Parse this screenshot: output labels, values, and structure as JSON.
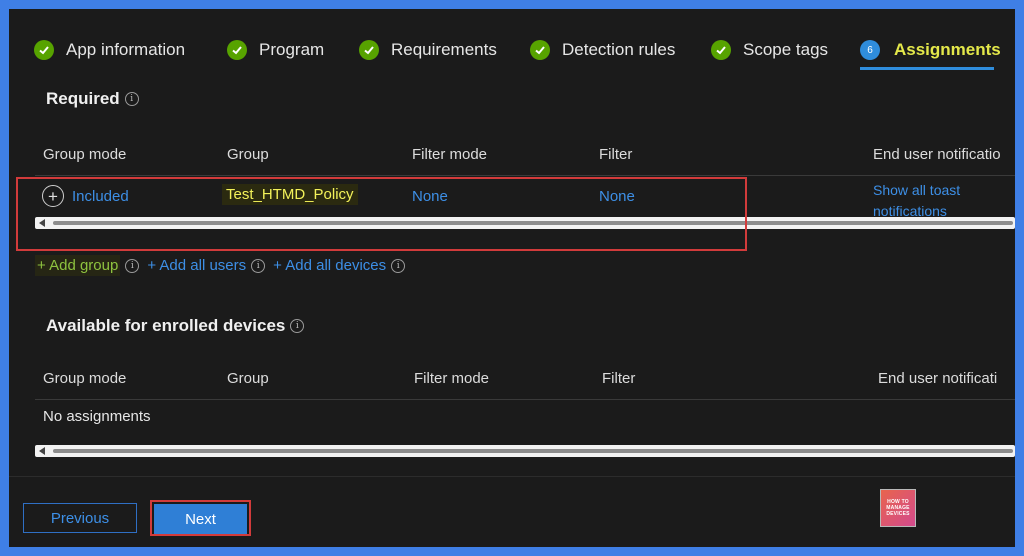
{
  "steps": [
    {
      "label": "App information",
      "state": "done"
    },
    {
      "label": "Program",
      "state": "done"
    },
    {
      "label": "Requirements",
      "state": "done"
    },
    {
      "label": "Detection rules",
      "state": "done"
    },
    {
      "label": "Scope tags",
      "state": "done"
    },
    {
      "label": "Assignments",
      "state": "active",
      "number": "6"
    }
  ],
  "required": {
    "title": "Required",
    "info": "i",
    "columns": [
      "Group mode",
      "Group",
      "Filter mode",
      "Filter",
      "End user notificatio"
    ],
    "row": {
      "group_mode": "Included",
      "group": "Test_HTMD_Policy",
      "filter_mode": "None",
      "filter": "None",
      "notification_line1": "Show all toast",
      "notification_line2": "notifications"
    },
    "actions": {
      "add_group": "+ Add group",
      "add_all_users": "+ Add all users",
      "add_all_devices": "+ Add all devices"
    }
  },
  "available": {
    "title": "Available for enrolled devices",
    "info": "i",
    "columns": [
      "Group mode",
      "Group",
      "Filter mode",
      "Filter",
      "End user notificati"
    ],
    "empty_text": "No assignments"
  },
  "footer": {
    "previous_label": "Previous",
    "next_label": "Next"
  },
  "logo": {
    "line1": "HOW TO",
    "line2": "MANAGE",
    "line3": "DEVICES"
  },
  "colors": {
    "accent": "#2f8ddc",
    "done": "#57a300",
    "highlight_box": "#d23b3b",
    "active_step": "#e4e84a"
  }
}
